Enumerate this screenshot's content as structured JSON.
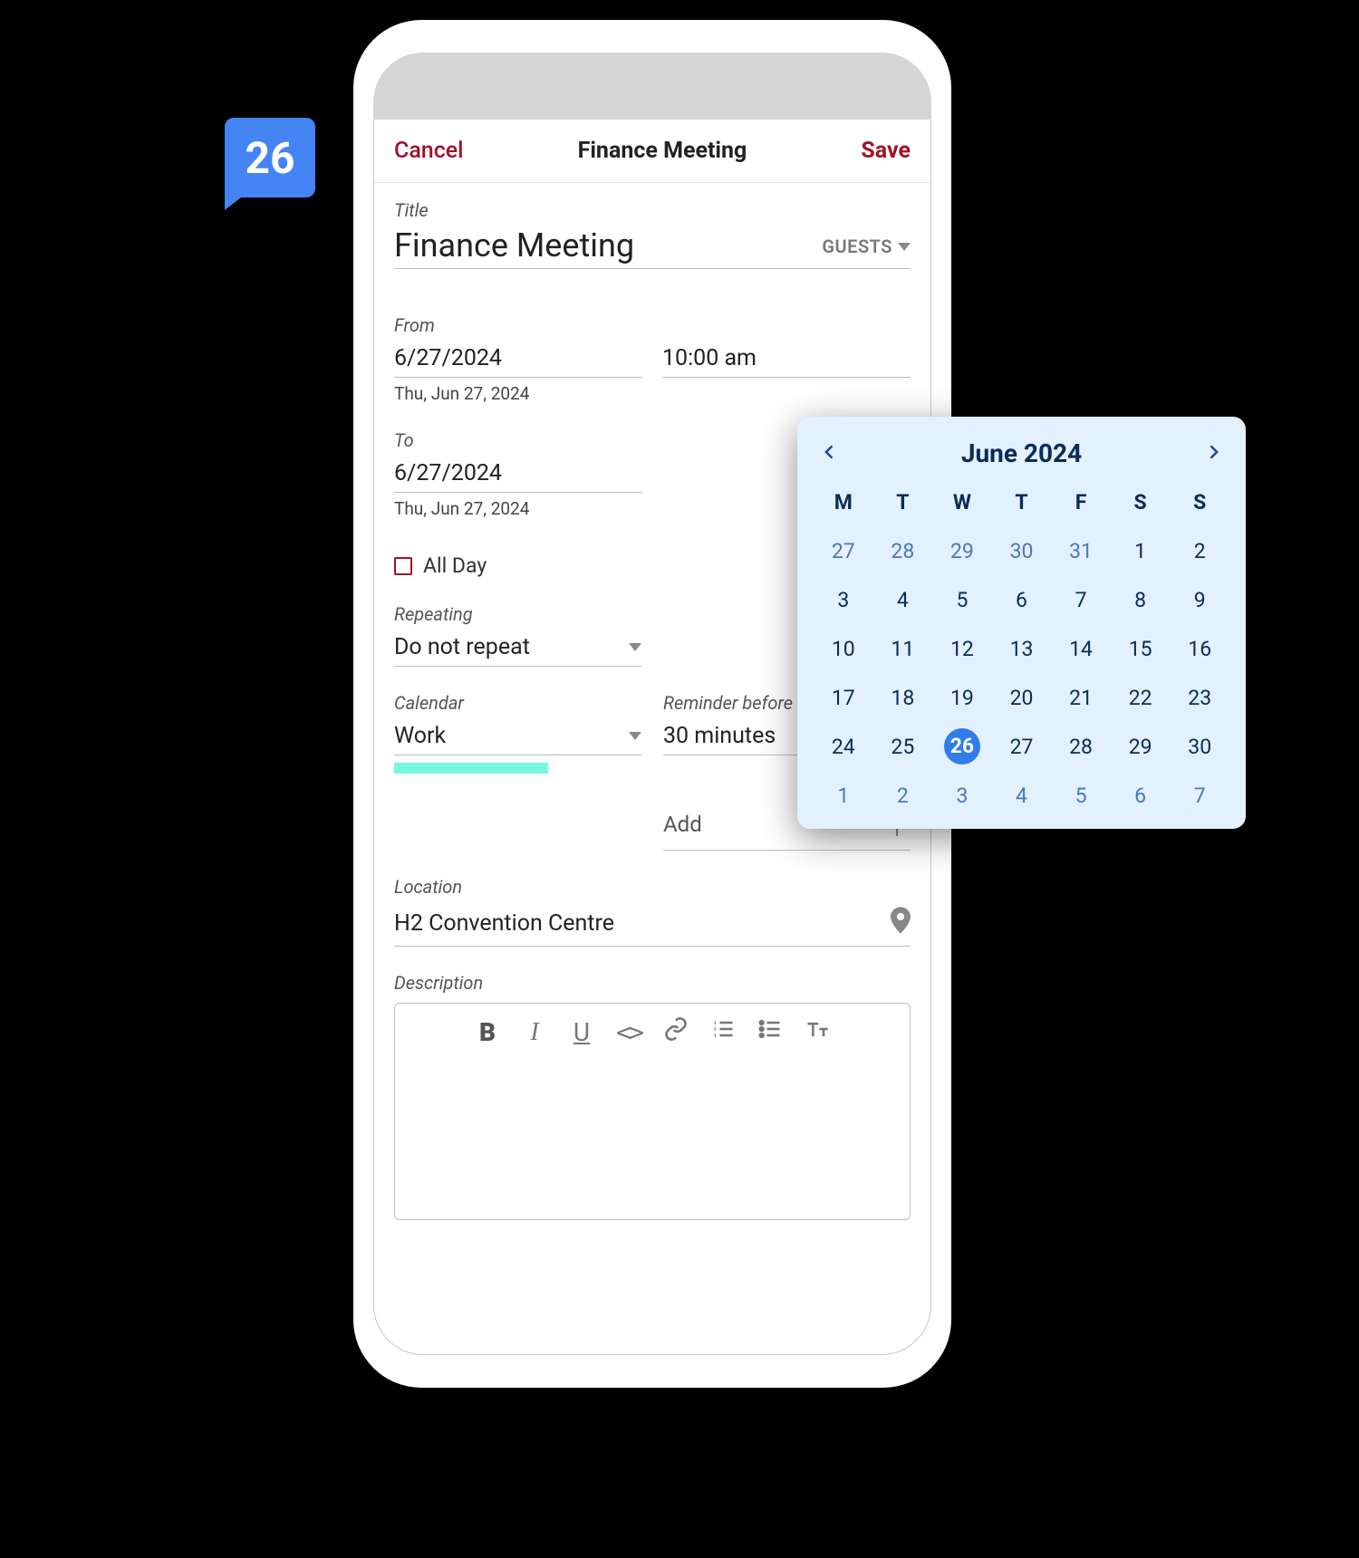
{
  "badge": {
    "value": "26"
  },
  "topbar": {
    "cancel": "Cancel",
    "title": "Finance Meeting",
    "save": "Save"
  },
  "event": {
    "titleLabel": "Title",
    "titleValue": "Finance Meeting",
    "guestsLabel": "GUESTS",
    "fromLabel": "From",
    "fromDate": "6/27/2024",
    "fromTime": "10:00 am",
    "fromDay": "Thu, Jun 27, 2024",
    "toLabel": "To",
    "toDate": "6/27/2024",
    "toDay": "Thu, Jun 27, 2024",
    "allDayLabel": "All Day",
    "repeatingLabel": "Repeating",
    "repeatingValue": "Do not repeat",
    "calendarLabel": "Calendar",
    "calendarValue": "Work",
    "reminderLabel": "Reminder before event",
    "reminderValue": "30 minutes",
    "addLabel": "Add",
    "locationLabel": "Location",
    "locationValue": "H2 Convention Centre",
    "descriptionLabel": "Description"
  },
  "picker": {
    "month": "June 2024",
    "dow": [
      "M",
      "T",
      "W",
      "T",
      "F",
      "S",
      "S"
    ],
    "grid": [
      [
        {
          "n": "27",
          "o": true
        },
        {
          "n": "28",
          "o": true
        },
        {
          "n": "29",
          "o": true
        },
        {
          "n": "30",
          "o": true
        },
        {
          "n": "31",
          "o": true
        },
        {
          "n": "1"
        },
        {
          "n": "2"
        }
      ],
      [
        {
          "n": "3"
        },
        {
          "n": "4"
        },
        {
          "n": "5"
        },
        {
          "n": "6"
        },
        {
          "n": "7"
        },
        {
          "n": "8"
        },
        {
          "n": "9"
        }
      ],
      [
        {
          "n": "10"
        },
        {
          "n": "11"
        },
        {
          "n": "12"
        },
        {
          "n": "13"
        },
        {
          "n": "14"
        },
        {
          "n": "15"
        },
        {
          "n": "16"
        }
      ],
      [
        {
          "n": "17"
        },
        {
          "n": "18"
        },
        {
          "n": "19"
        },
        {
          "n": "20"
        },
        {
          "n": "21"
        },
        {
          "n": "22"
        },
        {
          "n": "23"
        }
      ],
      [
        {
          "n": "24"
        },
        {
          "n": "25"
        },
        {
          "n": "26",
          "sel": true
        },
        {
          "n": "27"
        },
        {
          "n": "28"
        },
        {
          "n": "29"
        },
        {
          "n": "30"
        }
      ],
      [
        {
          "n": "1",
          "o": true
        },
        {
          "n": "2",
          "o": true
        },
        {
          "n": "3",
          "o": true
        },
        {
          "n": "4",
          "o": true
        },
        {
          "n": "5",
          "o": true
        },
        {
          "n": "6",
          "o": true
        },
        {
          "n": "7",
          "o": true
        }
      ]
    ]
  }
}
